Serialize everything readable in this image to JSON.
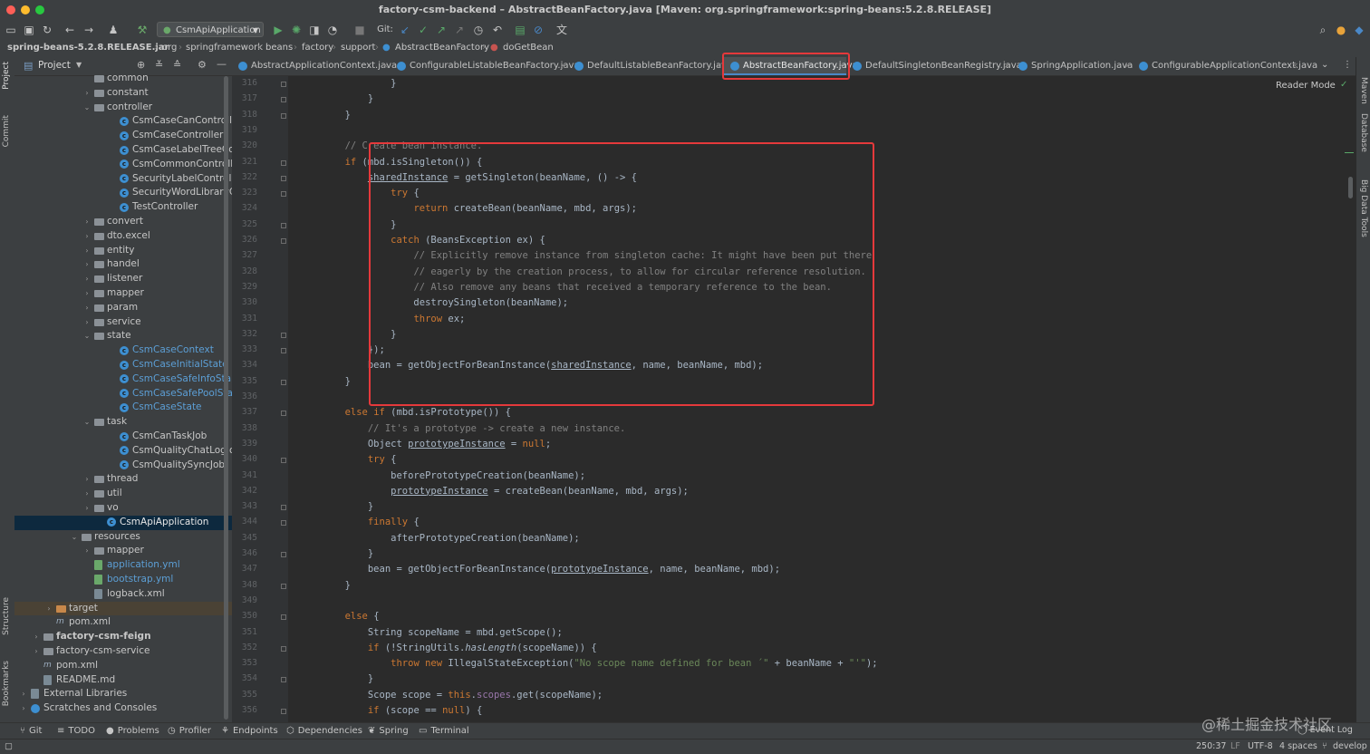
{
  "window": {
    "title": "factory-csm-backend – AbstractBeanFactory.java [Maven: org.springframework:spring-beans:5.2.8.RELEASE]"
  },
  "toolbar": {
    "run_config": "CsmApiApplication",
    "git_label": "Git:"
  },
  "breadcrumb": [
    "spring-beans-5.2.8.RELEASE.jar",
    "org",
    "springframework",
    "beans",
    "factory",
    "support",
    "AbstractBeanFactory",
    "doGetBean"
  ],
  "project_panel": {
    "title": "Project",
    "tree": [
      {
        "label": "common",
        "type": "folder",
        "depth": 6
      },
      {
        "label": "constant",
        "type": "folder",
        "depth": 6,
        "arrow": "›"
      },
      {
        "label": "controller",
        "type": "folder",
        "depth": 6,
        "arrow": "⌄"
      },
      {
        "label": "CsmCaseCanControlle",
        "type": "class",
        "depth": 8
      },
      {
        "label": "CsmCaseController",
        "type": "class",
        "depth": 8
      },
      {
        "label": "CsmCaseLabelTreeCo",
        "type": "class",
        "depth": 8
      },
      {
        "label": "CsmCommonControlle",
        "type": "class",
        "depth": 8
      },
      {
        "label": "SecurityLabelControlle",
        "type": "class",
        "depth": 8
      },
      {
        "label": "SecurityWordLibraryC",
        "type": "class",
        "depth": 8
      },
      {
        "label": "TestController",
        "type": "class",
        "depth": 8
      },
      {
        "label": "convert",
        "type": "folder",
        "depth": 6,
        "arrow": "›"
      },
      {
        "label": "dto.excel",
        "type": "folder",
        "depth": 6,
        "arrow": "›"
      },
      {
        "label": "entity",
        "type": "folder",
        "depth": 6,
        "arrow": "›"
      },
      {
        "label": "handel",
        "type": "folder",
        "depth": 6,
        "arrow": "›"
      },
      {
        "label": "listener",
        "type": "folder",
        "depth": 6,
        "arrow": "›"
      },
      {
        "label": "mapper",
        "type": "folder",
        "depth": 6,
        "arrow": "›"
      },
      {
        "label": "param",
        "type": "folder",
        "depth": 6,
        "arrow": "›"
      },
      {
        "label": "service",
        "type": "folder",
        "depth": 6,
        "arrow": "›"
      },
      {
        "label": "state",
        "type": "folder",
        "depth": 6,
        "arrow": "⌄"
      },
      {
        "label": "CsmCaseContext",
        "type": "class",
        "depth": 8,
        "color": "#5c9fd6"
      },
      {
        "label": "CsmCaseInitialState",
        "type": "class",
        "depth": 8,
        "color": "#5c9fd6"
      },
      {
        "label": "CsmCaseSafeInfoSta",
        "type": "class",
        "depth": 8,
        "color": "#5c9fd6"
      },
      {
        "label": "CsmCaseSafePoolSta",
        "type": "class",
        "depth": 8,
        "color": "#5c9fd6"
      },
      {
        "label": "CsmCaseState",
        "type": "class",
        "depth": 8,
        "color": "#5c9fd6"
      },
      {
        "label": "task",
        "type": "folder",
        "depth": 6,
        "arrow": "⌄"
      },
      {
        "label": "CsmCanTaskJob",
        "type": "class",
        "depth": 8
      },
      {
        "label": "CsmQualityChatLogJo",
        "type": "class",
        "depth": 8
      },
      {
        "label": "CsmQualitySyncJob",
        "type": "class",
        "depth": 8
      },
      {
        "label": "thread",
        "type": "folder",
        "depth": 6,
        "arrow": "›"
      },
      {
        "label": "util",
        "type": "folder",
        "depth": 6,
        "arrow": "›"
      },
      {
        "label": "vo",
        "type": "folder",
        "depth": 6,
        "arrow": "›"
      },
      {
        "label": "CsmApiApplication",
        "type": "class",
        "depth": 7,
        "selected": true
      },
      {
        "label": "resources",
        "type": "folder",
        "depth": 5,
        "arrow": "⌄"
      },
      {
        "label": "mapper",
        "type": "folder",
        "depth": 6,
        "arrow": "›"
      },
      {
        "label": "application.yml",
        "type": "yml",
        "depth": 6,
        "color": "#5c9fd6"
      },
      {
        "label": "bootstrap.yml",
        "type": "yml",
        "depth": 6,
        "color": "#5c9fd6"
      },
      {
        "label": "logback.xml",
        "type": "file",
        "depth": 6
      },
      {
        "label": "target",
        "type": "folder-orange",
        "depth": 3,
        "arrow": "›",
        "excluded": true
      },
      {
        "label": "pom.xml",
        "type": "maven",
        "depth": 3
      },
      {
        "label": "factory-csm-feign",
        "type": "folder",
        "depth": 2,
        "arrow": "›",
        "bold": true
      },
      {
        "label": "factory-csm-service",
        "type": "folder",
        "depth": 2,
        "arrow": "›"
      },
      {
        "label": "pom.xml",
        "type": "maven",
        "depth": 2
      },
      {
        "label": "README.md",
        "type": "file",
        "depth": 2
      },
      {
        "label": "External Libraries",
        "type": "lib",
        "depth": 1,
        "arrow": "›"
      },
      {
        "label": "Scratches and Consoles",
        "type": "scratch",
        "depth": 1,
        "arrow": "›"
      }
    ]
  },
  "tabs": [
    {
      "label": "AbstractApplicationContext.java",
      "active": false
    },
    {
      "label": "ConfigurableListableBeanFactory.java",
      "active": false
    },
    {
      "label": "DefaultListableBeanFactory.java",
      "active": false
    },
    {
      "label": "AbstractBeanFactory.java",
      "active": true
    },
    {
      "label": "DefaultSingletonBeanRegistry.java",
      "active": false
    },
    {
      "label": "SpringApplication.java",
      "active": false
    },
    {
      "label": "ConfigurableApplicationContext.java",
      "active": false
    }
  ],
  "editor": {
    "reader_mode": "Reader Mode",
    "line_numbers": [
      "316",
      "317",
      "318",
      "319",
      "320",
      "321",
      "322",
      "323",
      "324",
      "325",
      "326",
      "327",
      "328",
      "329",
      "330",
      "331",
      "332",
      "333",
      "334",
      "335",
      "336",
      "337",
      "338",
      "339",
      "340",
      "341",
      "342",
      "343",
      "344",
      "345",
      "346",
      "347",
      "348",
      "349",
      "350",
      "351",
      "352",
      "353",
      "354",
      "355",
      "356"
    ],
    "code_lines": [
      "                }",
      "            }",
      "        }",
      "",
      "        // Create bean instance.",
      "        if (mbd.isSingleton()) {",
      "            sharedInstance = getSingleton(beanName, () -> {",
      "                try {",
      "                    return createBean(beanName, mbd, args);",
      "                }",
      "                catch (BeansException ex) {",
      "                    // Explicitly remove instance from singleton cache: It might have been put there",
      "                    // eagerly by the creation process, to allow for circular reference resolution.",
      "                    // Also remove any beans that received a temporary reference to the bean.",
      "                    destroySingleton(beanName);",
      "                    throw ex;",
      "                }",
      "            });",
      "            bean = getObjectForBeanInstance(sharedInstance, name, beanName, mbd);",
      "        }",
      "",
      "        else if (mbd.isPrototype()) {",
      "            // It's a prototype -> create a new instance.",
      "            Object prototypeInstance = null;",
      "            try {",
      "                beforePrototypeCreation(beanName);",
      "                prototypeInstance = createBean(beanName, mbd, args);",
      "            }",
      "            finally {",
      "                afterPrototypeCreation(beanName);",
      "            }",
      "            bean = getObjectForBeanInstance(prototypeInstance, name, beanName, mbd);",
      "        }",
      "",
      "        else {",
      "            String scopeName = mbd.getScope();",
      "            if (!StringUtils.hasLength(scopeName)) {",
      "                throw new IllegalStateException(\"No scope name defined for bean ´\" + beanName + \"'\");",
      "            }",
      "            Scope scope = this.scopes.get(scopeName);",
      "            if (scope == null) {"
    ]
  },
  "right_strip": [
    "Maven",
    "Database",
    "Big Data Tools"
  ],
  "left_strip": [
    "Project",
    "Commit",
    "Structure",
    "Bookmarks"
  ],
  "bottom_tools": [
    "Git",
    "TODO",
    "Problems",
    "Profiler",
    "Endpoints",
    "Dependencies",
    "Spring",
    "Terminal"
  ],
  "event_log": "Event Log",
  "status": {
    "position": "250:37",
    "line_sep": "LF",
    "encoding": "UTF-8",
    "indent": "4 spaces",
    "branch": "develop"
  },
  "watermark": "@稀土掘金技术社区",
  "colors": {
    "highlight": "#e5393b",
    "keyword": "#cc7832",
    "comment": "#808080",
    "field": "#9876aa",
    "selection": "#0d293e"
  }
}
